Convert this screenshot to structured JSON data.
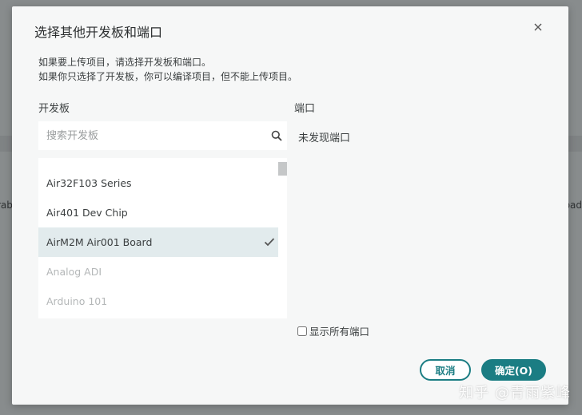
{
  "background": {
    "left_fragment": "rab",
    "right_fragment": "oad"
  },
  "watermark": "知乎 @青雨紫峰",
  "dialog": {
    "title": "选择其他开发板和端口",
    "hint_line1": "如果要上传项目，请选择开发板和端口。",
    "hint_line2": "如果你只选择了开发板，你可以编译项目，但不能上传项目。",
    "board_label": "开发板",
    "port_label": "端口",
    "search": {
      "placeholder": "搜索开发板",
      "value": ""
    },
    "board_list": {
      "partial_item": "...",
      "items": [
        {
          "label": "Air32F103 Series",
          "state": "normal"
        },
        {
          "label": "Air401 Dev Chip",
          "state": "normal"
        },
        {
          "label": "AirM2M Air001 Board",
          "state": "selected"
        },
        {
          "label": "Analog ADI",
          "state": "disabled"
        },
        {
          "label": "Arduino 101",
          "state": "disabled"
        }
      ]
    },
    "port_empty_text": "未发现端口",
    "show_all_ports_label": "显示所有端口",
    "show_all_ports_checked": false,
    "cancel_label": "取消",
    "ok_label": "确定(O)"
  },
  "colors": {
    "accent": "#1b7d83",
    "selected_row": "#e2ebed",
    "dialog_bg": "#f6f7f7"
  }
}
